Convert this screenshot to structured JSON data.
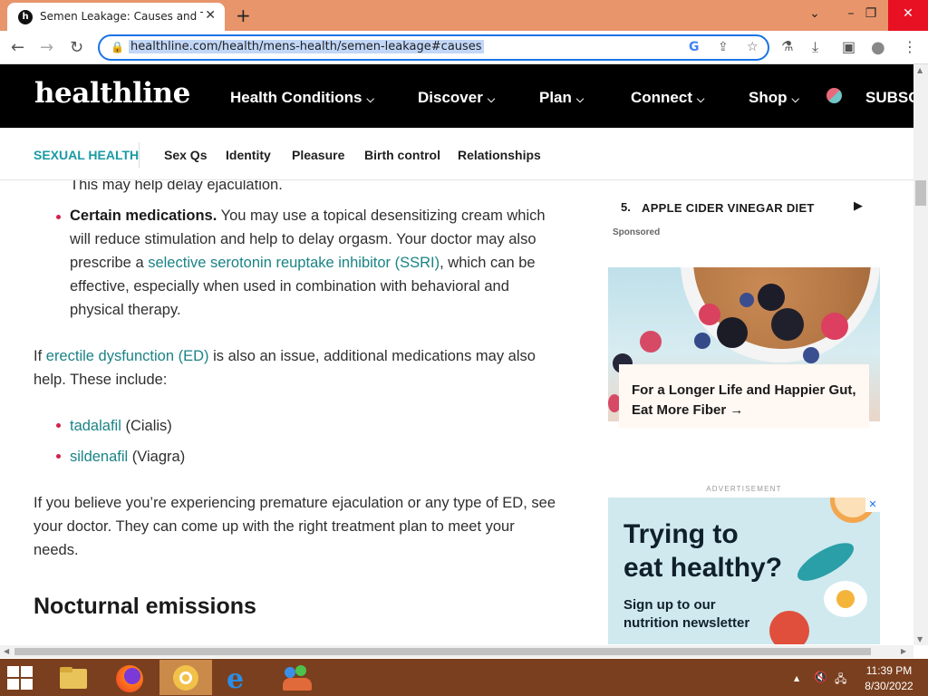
{
  "browser": {
    "tab_title": "Semen Leakage: Causes and Trea",
    "tab_favicon": "h",
    "tab_close": "✕",
    "new_tab": "+",
    "url": "healthline.com/health/mens-health/semen-leakage#causes",
    "window_controls": {
      "dropdown": "⌄",
      "minimize": "–",
      "restore": "❐",
      "close": "✕"
    },
    "toolbar_icons": {
      "back": "←",
      "forward": "→",
      "reload": "↻",
      "lock": "🔒",
      "google": "G",
      "share": "⇪",
      "star": "☆",
      "labs": "⚗",
      "download": "⤓",
      "sidepanel": "▣",
      "profile": "●",
      "menu": "⋮"
    }
  },
  "site": {
    "logo": "healthline",
    "nav": [
      {
        "label": "Health Conditions",
        "chev": "⌵"
      },
      {
        "label": "Discover",
        "chev": "⌵"
      },
      {
        "label": "Plan",
        "chev": "⌵"
      },
      {
        "label": "Connect",
        "chev": "⌵"
      },
      {
        "label": "Shop",
        "chev": "⌵"
      }
    ],
    "subscribe": "SUBSC",
    "subnav": {
      "title": "SEXUAL HEALTH",
      "items": [
        "Sex Qs",
        "Identity",
        "Pleasure",
        "Birth control",
        "Relationships"
      ]
    }
  },
  "article": {
    "line_top": "This may help delay ejaculation.",
    "med_bold": "Certain medications.",
    "med_text_1": " You may use a topical desensitizing cream which will reduce stimulation and help to delay orgasm. Your doctor may also prescribe a ",
    "med_link": "selective serotonin reuptake inhibitor (SSRI)",
    "med_text_2": ", which can be effective, especially when used in combination with behavioral and physical therapy.",
    "ed_text_1": "If ",
    "ed_link": "erectile dysfunction (ED)",
    "ed_text_2": " is also an issue, additional medications may also help. These include:",
    "drugs": [
      {
        "link": "tadalafil",
        "text": " (Cialis)"
      },
      {
        "link": "sildenafil",
        "text": " (Viagra)"
      }
    ],
    "closing": "If you believe you’re experiencing premature ejaculation or any type of ED, see your doctor. They can come up with the right treatment plan to meet your needs.",
    "heading": "Nocturnal emissions"
  },
  "sidebar": {
    "list_num": "5.",
    "list_text": "APPLE CIDER VINEGAR DIET",
    "list_arrow": "▶",
    "sponsored": "Sponsored",
    "promo_text": "For a Longer Life and Happier Gut, Eat More Fiber →",
    "ad_label": "ADVERTISEMENT",
    "ad_close": "✕",
    "ad_head_1": "Trying to",
    "ad_head_2": "eat healthy?",
    "ad_sub_1": "Sign up to our",
    "ad_sub_2": "nutrition newsletter"
  },
  "taskbar": {
    "time": "11:39 PM",
    "date": "8/30/2022",
    "tray_icons": {
      "show_hidden": "▲",
      "volume": "🔇",
      "network": "🖧"
    }
  },
  "colors": {
    "tabbar": "#e8956b",
    "brand_teal": "#1a9ba3",
    "link": "#1b8386",
    "bullet": "#d6204a",
    "taskbar": "#7a3f1e"
  }
}
